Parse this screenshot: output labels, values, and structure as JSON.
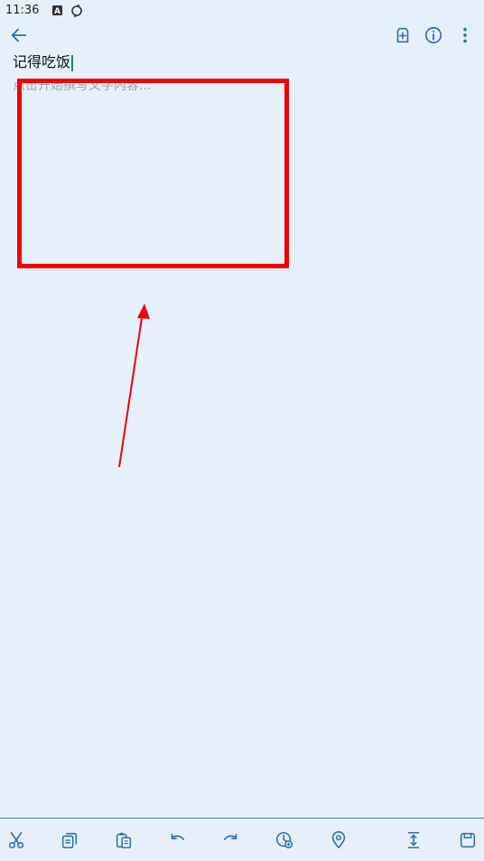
{
  "status_bar": {
    "time": "11:36",
    "icons": [
      "keyboard-a-icon",
      "sync-icon"
    ]
  },
  "app_bar": {
    "back_icon": "arrow-back-icon",
    "actions": [
      "add-tag-icon",
      "info-icon",
      "more-vert-icon"
    ]
  },
  "note": {
    "title": "记得吃饭",
    "body_placeholder": "点击开始撰写文字内容..."
  },
  "annotation": {
    "box_color": "#f20000",
    "arrow_color": "#f20000"
  },
  "toolbar": {
    "items": [
      "cut-icon",
      "copy-icon",
      "paste-icon",
      "undo-icon",
      "redo-icon",
      "add-time-icon",
      "location-icon",
      "expand-icon",
      "save-icon"
    ]
  },
  "colors": {
    "background": "#e6f0fa",
    "accent": "#2f6fb0",
    "placeholder": "#9aa3ad"
  }
}
